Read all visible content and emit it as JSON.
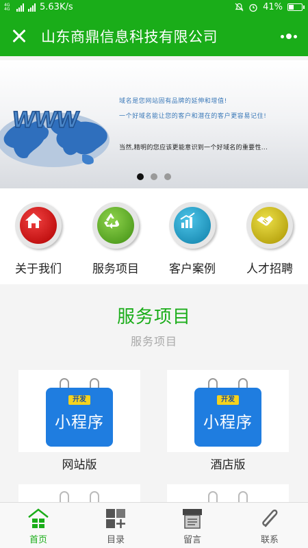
{
  "status_bar": {
    "network_label": "4G 4G",
    "speed": "5.63K/s",
    "battery": "41%",
    "icons": [
      "signal-icon",
      "mute-icon",
      "alarm-icon",
      "battery-icon"
    ]
  },
  "title_bar": {
    "title": "山东商鼎信息科技有限公司",
    "close_icon": "close-icon",
    "more_icon": "more-icon"
  },
  "banner": {
    "line1": "域名是您网站固有品牌的延伸和增值!",
    "line2": "一个好域名能让您的客户和潜在的客户更容易记住!",
    "line3": "当然,精明的您应该更能意识到一个好域名的重要性...",
    "www_text": "WWW",
    "slide_count": 3,
    "active_slide": 1
  },
  "quick_nav": [
    {
      "label": "关于我们",
      "icon": "home-icon",
      "color": "#cc0e0e"
    },
    {
      "label": "服务项目",
      "icon": "recycle-icon",
      "color": "#5fae24"
    },
    {
      "label": "客户案例",
      "icon": "chart-icon",
      "color": "#1d9bc4"
    },
    {
      "label": "人才招聘",
      "icon": "handshake-icon",
      "color": "#c9b614"
    }
  ],
  "section": {
    "title": "服务项目",
    "subtitle": "服务项目"
  },
  "cards": [
    {
      "label": "网站版",
      "tag": "开发",
      "image_text": "小程序"
    },
    {
      "label": "酒店版",
      "tag": "开发",
      "image_text": "小程序"
    }
  ],
  "tab_bar": [
    {
      "label": "首页",
      "icon": "home-grid-icon",
      "active": true
    },
    {
      "label": "目录",
      "icon": "catalog-icon",
      "active": false
    },
    {
      "label": "留言",
      "icon": "message-box-icon",
      "active": false
    },
    {
      "label": "联系",
      "icon": "paperclip-icon",
      "active": false
    }
  ],
  "colors": {
    "brand": "#1aad19",
    "subtitle_gray": "#a8a8a8",
    "banner_text": "#3a78b8",
    "card_blue": "#1f7de0"
  }
}
